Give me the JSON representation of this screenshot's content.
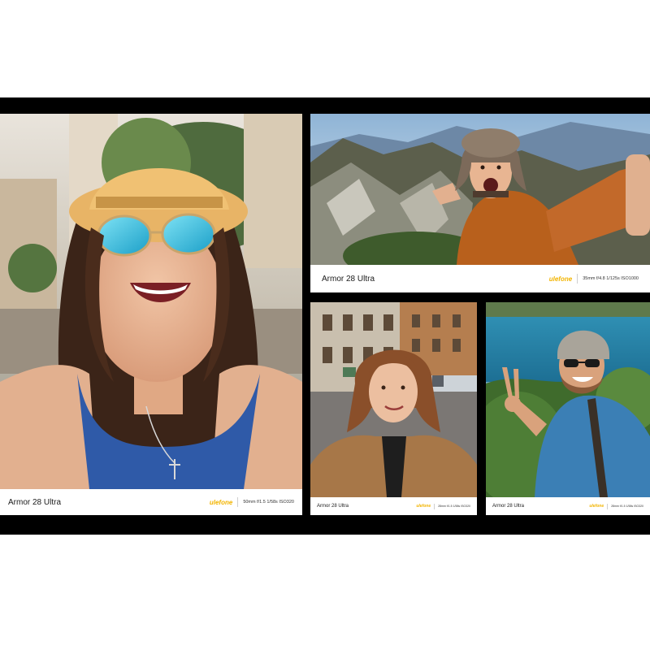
{
  "photos": [
    {
      "subject": "woman-hat-sunglasses",
      "model": "Armor 28 Ultra",
      "brand": "ulefone",
      "params": "50mm  f/1.5  1/58s  ISO320"
    },
    {
      "subject": "man-mountain-hat",
      "model": "Armor 28 Ultra",
      "brand": "ulefone",
      "params": "35mm  f/4.8  1/125s  ISO1000"
    },
    {
      "subject": "woman-street",
      "model": "Armor 28 Ultra",
      "brand": "ulefone",
      "params": "28mm  f/1.5  1/58s  ISO320"
    },
    {
      "subject": "man-sea-peace-sign",
      "model": "Armor 28 Ultra",
      "brand": "ulefone",
      "params": "28mm  f/1.5  1/58s  ISO320"
    }
  ],
  "colors": {
    "band": "#000000",
    "brand": "#f2b400"
  }
}
